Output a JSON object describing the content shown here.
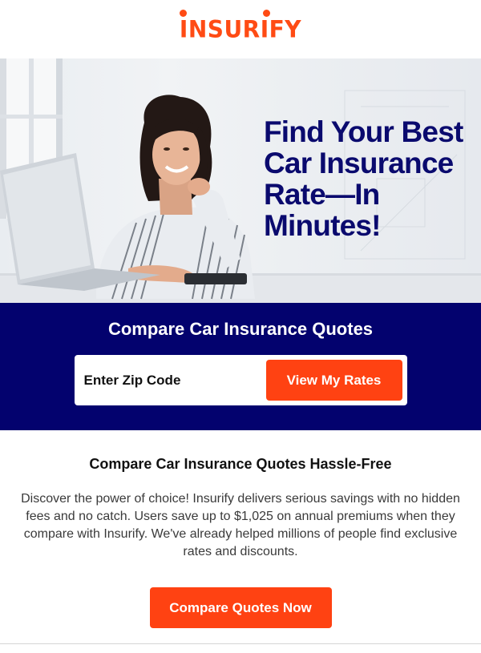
{
  "brand": {
    "logo_text": "INSURIFY",
    "accent_color": "#ff4b14",
    "navy_color": "#03026e"
  },
  "hero": {
    "title_lines": [
      "Find Your Best",
      "Car Insurance",
      "Rate—In",
      "Minutes!"
    ],
    "image_description_icon": "woman-at-laptop-photo"
  },
  "quote_form": {
    "title": "Compare Car Insurance Quotes",
    "zip_placeholder": "Enter Zip Code",
    "zip_value": "",
    "submit_label": "View My Rates"
  },
  "content": {
    "heading": "Compare Car Insurance Quotes Hassle-Free",
    "body": "Discover the power of choice! Insurify delivers serious savings with no hidden fees and no catch. Users save up to $1,025 on annual premiums when they compare with Insurify. We've already helped millions of people find exclusive rates and discounts.",
    "cta_label": "Compare Quotes Now"
  }
}
